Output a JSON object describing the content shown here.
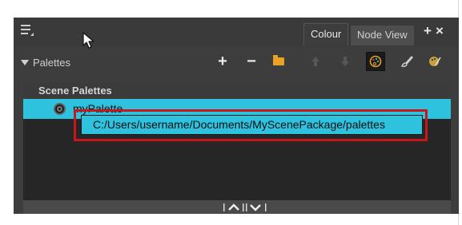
{
  "topbar": {
    "tabs": [
      {
        "label": "Colour",
        "active": true
      },
      {
        "label": "Node View",
        "active": false
      }
    ],
    "add_label": "+",
    "close_label": "×"
  },
  "toolbar": {
    "palettes_label": "Palettes",
    "add_icon": "+",
    "remove_icon": "−",
    "icons": [
      "add-icon",
      "remove-icon",
      "folder-icon",
      "move-up-icon",
      "move-down-icon",
      "palette-icon",
      "brush-icon",
      "palette-clone-icon"
    ]
  },
  "list": {
    "header": "Scene Palettes",
    "rows": [
      {
        "label": "myPalette",
        "selected": true,
        "icon": "palette-link-icon"
      }
    ]
  },
  "tooltip": {
    "text": "C:/Users/username/Documents/MyScenePackage/palettes"
  },
  "bottombar": {
    "splitter_label": "|⌃||⌄|"
  },
  "colors": {
    "selection": "#2ec2de",
    "highlight_outline": "#c9161b",
    "panel_bg": "#3d3d3d",
    "list_bg": "#262626",
    "folder": "#e8a325"
  }
}
